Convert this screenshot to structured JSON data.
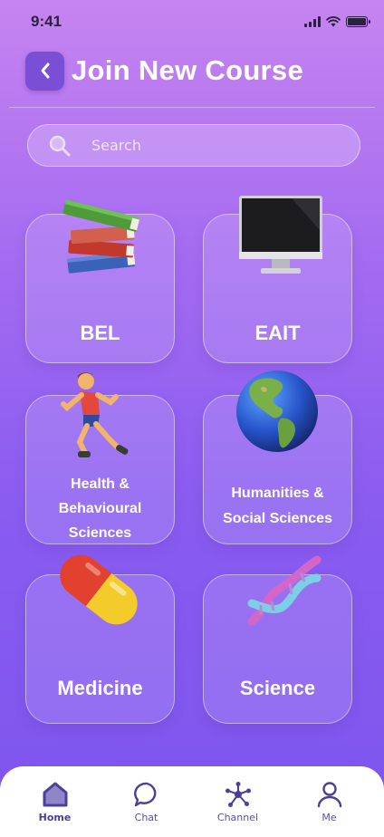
{
  "status_bar": {
    "time": "9:41"
  },
  "header": {
    "title": "Join New Course"
  },
  "search": {
    "placeholder": "Search"
  },
  "courses": [
    {
      "label": "BEL",
      "icon": "books-icon"
    },
    {
      "label": "EAIT",
      "icon": "desktop-computer-icon"
    },
    {
      "label": "Health &\nBehavioural\nSciences",
      "icon": "running-person-icon"
    },
    {
      "label": "Humanities &\nSocial Sciences",
      "icon": "globe-americas-icon"
    },
    {
      "label": "Medicine",
      "icon": "pill-icon"
    },
    {
      "label": "Science",
      "icon": "dna-icon"
    }
  ],
  "nav": {
    "items": [
      {
        "label": "Home",
        "icon": "home-icon",
        "active": true
      },
      {
        "label": "Chat",
        "icon": "chat-bubble-icon",
        "active": false
      },
      {
        "label": "Channel",
        "icon": "network-icon",
        "active": false
      },
      {
        "label": "Me",
        "icon": "user-icon",
        "active": false
      }
    ]
  },
  "colors": {
    "accent": "#7a4fd6",
    "nav_icon": "#4a3f9a",
    "background_top": "#c684f0",
    "background_bottom": "#7d55ee"
  }
}
